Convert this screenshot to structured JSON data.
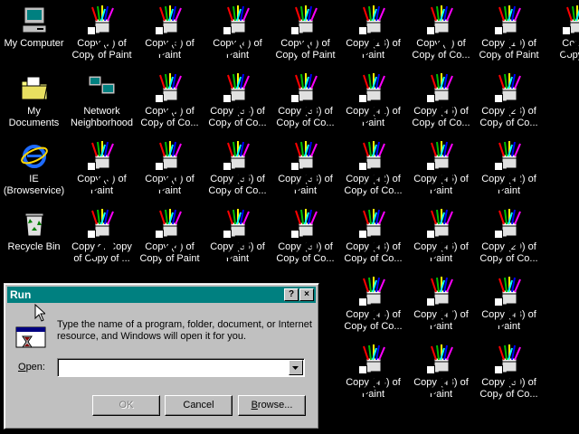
{
  "desktop": {
    "icons": [
      {
        "label": "My Computer",
        "type": "computer"
      },
      {
        "label": "Copy (2) of\nCopy of Paint",
        "type": "paint"
      },
      {
        "label": "Copy (5) of\nPaint",
        "type": "paint"
      },
      {
        "label": "Copy (8) of\nPaint",
        "type": "paint"
      },
      {
        "label": "Copy (6) of\nCopy of Paint",
        "type": "paint"
      },
      {
        "label": "Copy (13) of\nPaint",
        "type": "paint"
      },
      {
        "label": "Copy (7) of\nCopy of Co...",
        "type": "paint"
      },
      {
        "label": "Copy (10) of\nCopy of Paint",
        "type": "paint"
      },
      {
        "label": "Copy (\nCopy of",
        "type": "paint"
      },
      {
        "label": "My Documents",
        "type": "documents"
      },
      {
        "label": "Network\nNeighborhood",
        "type": "network"
      },
      {
        "label": "Copy (2) of\nCopy of Co...",
        "type": "paint"
      },
      {
        "label": "Copy (34) of\nCopy of Co...",
        "type": "paint"
      },
      {
        "label": "Copy (38) of\nCopy of Co...",
        "type": "paint"
      },
      {
        "label": "Copy (41) of\nPaint",
        "type": "paint"
      },
      {
        "label": "Copy (45) of\nCopy of Co...",
        "type": "paint"
      },
      {
        "label": "Copy (28) of\nCopy of Co...",
        "type": "paint"
      },
      {
        "label": "IE\n(Browservice)",
        "type": "ie"
      },
      {
        "label": "Copy (3) of\nPaint",
        "type": "paint"
      },
      {
        "label": "Copy (6) of\nPaint",
        "type": "paint"
      },
      {
        "label": "Copy (35) of\nCopy of Co...",
        "type": "paint"
      },
      {
        "label": "Copy (38) of\nPaint",
        "type": "paint"
      },
      {
        "label": "Copy (42) of\nCopy of Co...",
        "type": "paint"
      },
      {
        "label": "Copy (45) of\nPaint",
        "type": "paint"
      },
      {
        "label": "Copy (42) of\nPaint",
        "type": "paint"
      },
      {
        "label": "Recycle Bin",
        "type": "recycle"
      },
      {
        "label": "Copy of Copy\nof Copy of ...",
        "type": "paint"
      },
      {
        "label": "Copy (4) of\nCopy of Paint",
        "type": "paint"
      },
      {
        "label": "Copy (35) of\nPaint",
        "type": "paint"
      },
      {
        "label": "Copy (39) of\nCopy of Co...",
        "type": "paint"
      },
      {
        "label": "Copy (43) of\nCopy of Co...",
        "type": "paint"
      },
      {
        "label": "Copy (46) of\nPaint",
        "type": "paint"
      },
      {
        "label": "Copy (29) of\nCopy of Co...",
        "type": "paint"
      },
      {
        "label": "Copy (44) of\nCopy of Co...",
        "type": "paint"
      },
      {
        "label": "Copy (47) of\nPaint",
        "type": "paint"
      },
      {
        "label": "Copy (43) of\nPaint",
        "type": "paint"
      },
      {
        "label": "Copy (44) of\nPaint",
        "type": "paint"
      },
      {
        "label": "Copy (48) of\nPaint",
        "type": "paint"
      },
      {
        "label": "Copy (30) of\nCopy of Co...",
        "type": "paint"
      }
    ]
  },
  "run_dialog": {
    "title": "Run",
    "help_button": "?",
    "close_button": "×",
    "message": "Type the name of a program, folder, document, or Internet resource, and Windows will open it for you.",
    "open_label_accel": "O",
    "open_label_rest": "pen:",
    "open_value": "",
    "ok_label": "OK",
    "cancel_label": "Cancel",
    "browse_accel": "B",
    "browse_rest": "rowse..."
  },
  "colors": {
    "desktop": "#000000",
    "titlebar": "#008080",
    "window_face": "#c0c0c0"
  }
}
